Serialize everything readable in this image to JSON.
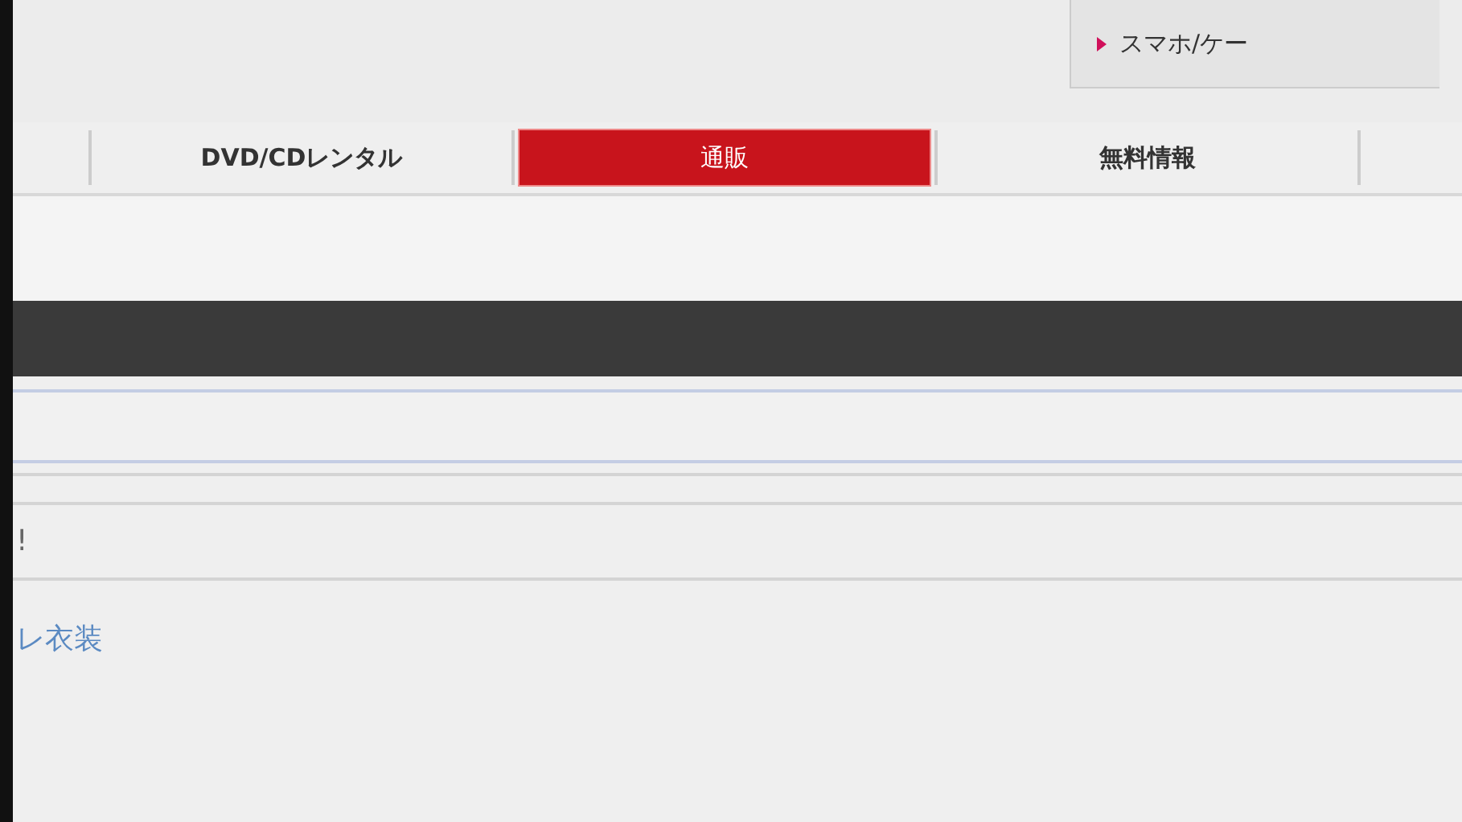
{
  "header_link": {
    "label": "スマホ/ケー"
  },
  "nav_tabs": [
    {
      "label": "DVD/CDレンタル",
      "selected": false
    },
    {
      "label": "通販",
      "selected": true
    },
    {
      "label": "無料情報",
      "selected": false
    }
  ],
  "notice": {
    "text": "!"
  },
  "category_link": {
    "label": "レ衣装"
  }
}
